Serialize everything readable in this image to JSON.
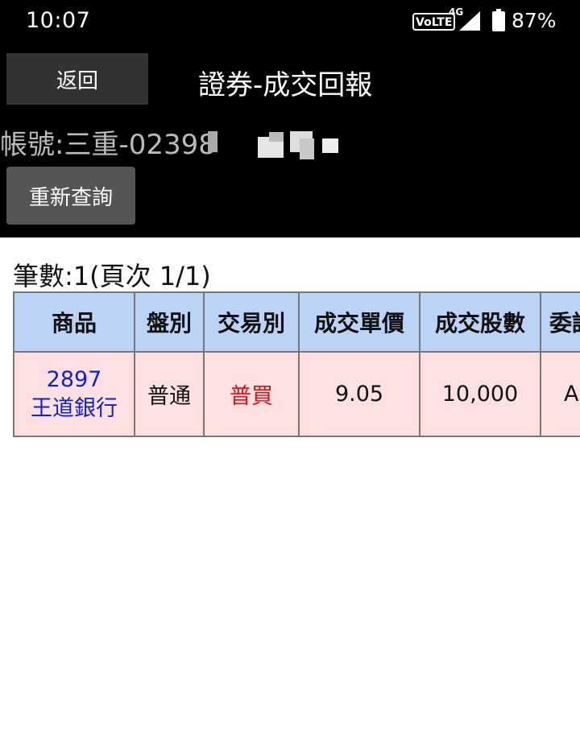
{
  "status_bar": {
    "time": "10:07",
    "volte": "VoLTE",
    "network": "4G",
    "battery": "87%"
  },
  "header": {
    "back_label": "返回",
    "title": "證券-成交回報",
    "account": "帳號:三重-02398",
    "requery_label": "重新查詢"
  },
  "summary": {
    "count_text": "筆數:1(頁次 1/1)"
  },
  "table": {
    "columns": [
      "商品",
      "盤別",
      "交易別",
      "成交單價",
      "成交股數",
      "委託"
    ],
    "rows": [
      {
        "code": "2897",
        "name": "王道銀行",
        "session": "普通",
        "trade_type": "普買",
        "price": "9.05",
        "shares": "10,000",
        "order": "A"
      }
    ]
  },
  "colors": {
    "header_bg": "#000000",
    "table_header_bg": "#bcd3f5",
    "row_bg": "#fde0e2",
    "product_text": "#1020cc",
    "buy_text": "#dd1111"
  }
}
